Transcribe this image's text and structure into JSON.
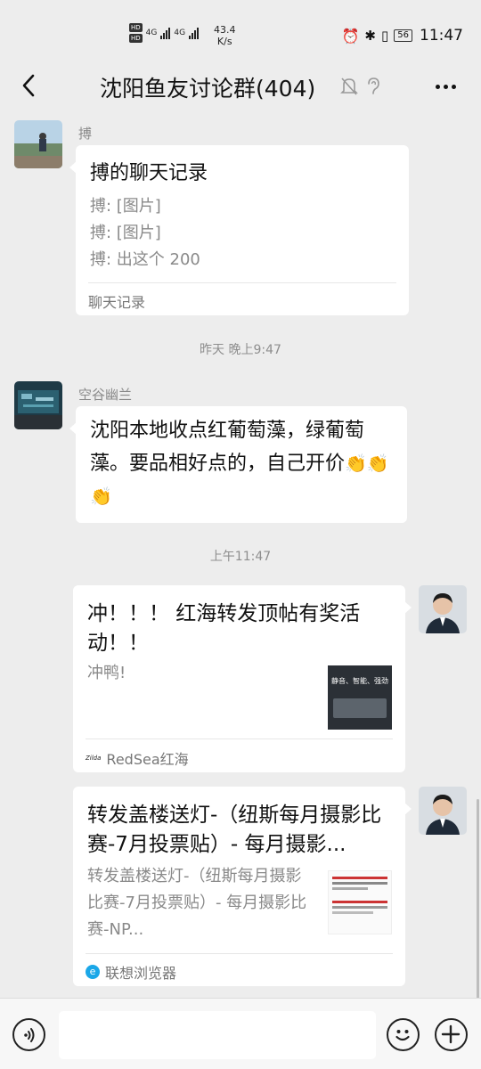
{
  "status_bar": {
    "net_type_1": "4G",
    "net_type_2": "4G",
    "speed_value": "43.4",
    "speed_unit": "K/s",
    "battery": "56",
    "time": "11:47"
  },
  "header": {
    "title": "沈阳鱼友讨论群(404)"
  },
  "messages": [
    {
      "sender": "搏",
      "card_title": "搏的聊天记录",
      "lines": [
        "搏: [图片]",
        "搏: [图片]",
        "搏: 出这个 200"
      ],
      "footer": "聊天记录"
    },
    {
      "timestamp": "昨天 晚上9:47"
    },
    {
      "sender": "空谷幽兰",
      "text": "沈阳本地收点红葡萄藻，绿葡萄藻。要品相好点的，自己开价",
      "emoji": "👏👏👏"
    },
    {
      "timestamp": "上午11:47"
    },
    {
      "card_title": "冲！！！ 红海转发顶帖有奖活动！！",
      "desc": "冲鸭!",
      "thumb_text": "静音、智能、强劲",
      "footer": "RedSea红海",
      "footer_logo": "Zilda"
    },
    {
      "card_title": "转发盖楼送灯-（纽斯每月摄影比赛-7月投票贴）- 每月摄影...",
      "desc": "转发盖楼送灯-（纽斯每月摄影比赛-7月投票贴）- 每月摄影比赛-NP...",
      "footer": "联想浏览器"
    }
  ],
  "colors": {
    "background": "#ededed",
    "bubble": "#ffffff",
    "muted_text": "#8a8a8a",
    "browser_icon": "#1aa7e8"
  }
}
